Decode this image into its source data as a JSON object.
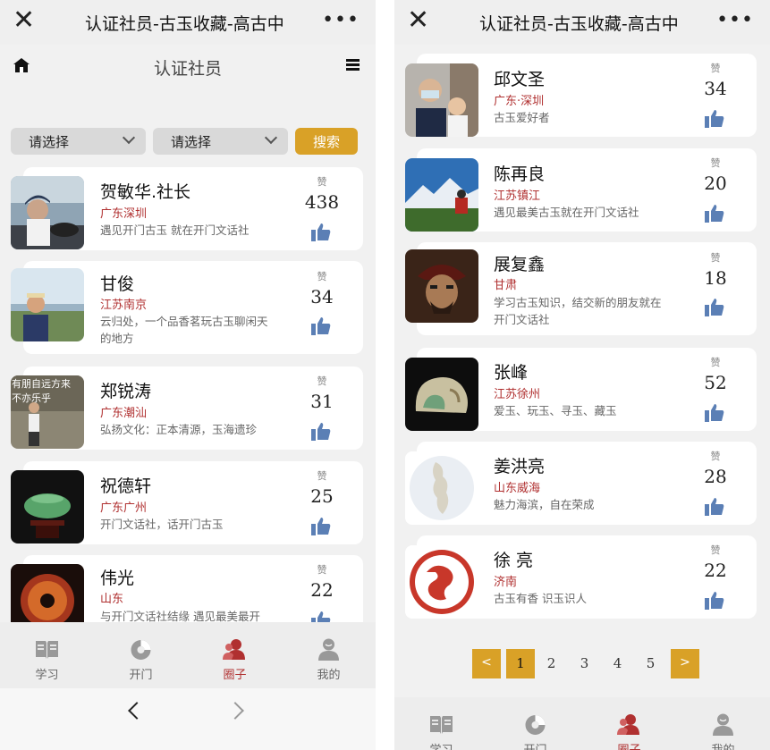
{
  "app": {
    "title": "认证社员-古玉收藏-高古中",
    "page_title": "认证社员",
    "close": "✕",
    "more": "•••"
  },
  "filters": {
    "select1": "请选择",
    "select2": "请选择",
    "search": "搜索"
  },
  "like_label": "赞",
  "left_members": [
    {
      "name": "贺敏华.社长",
      "location": "广东深圳",
      "motto": "遇见开门古玉 就在开门文话社",
      "likes": "438"
    },
    {
      "name": "甘俊",
      "location": "江苏南京",
      "motto": "云归处，一个品香茗玩古玉聊闲天的地方",
      "likes": "34"
    },
    {
      "name": "郑锐涛",
      "location": "广东潮汕",
      "motto": "弘扬文化：正本清源，玉海遗珍",
      "likes": "31",
      "photo_text": "有朋自远方来 不亦乐乎"
    },
    {
      "name": "祝德轩",
      "location": "广东广州",
      "motto": "开门文话社，话开门古玉",
      "likes": "25"
    },
    {
      "name": "伟光",
      "location": "山东",
      "motto": "与开门文话社结缘 遇见最美最开",
      "likes": "22"
    }
  ],
  "right_members": [
    {
      "name": "邱文圣",
      "location": "广东·深圳",
      "motto": "古玉爱好者",
      "likes": "34"
    },
    {
      "name": "陈再良",
      "location": "江苏镇江",
      "motto": "遇见最美古玉就在开门文话社",
      "likes": "20"
    },
    {
      "name": "展复鑫",
      "location": "甘肃",
      "motto": "学习古玉知识，结交新的朋友就在开门文话社",
      "likes": "18"
    },
    {
      "name": "张峰",
      "location": "江苏徐州",
      "motto": "爱玉、玩玉、寻玉、藏玉",
      "likes": "52"
    },
    {
      "name": "姜洪亮",
      "location": "山东威海",
      "motto": "魅力海滨，自在荣成",
      "likes": "28"
    },
    {
      "name": "徐 亮",
      "location": "济南",
      "motto": "古玉有香 识玉识人",
      "likes": "22"
    }
  ],
  "pagination": {
    "prev": "<",
    "next": ">",
    "pages": [
      "1",
      "2",
      "3",
      "4",
      "5"
    ],
    "current": "1"
  },
  "tabs": [
    {
      "label": "学习",
      "icon": "book-icon"
    },
    {
      "label": "开门",
      "icon": "jade-disc-icon"
    },
    {
      "label": "圈子",
      "icon": "people-icon"
    },
    {
      "label": "我的",
      "icon": "user-icon"
    }
  ],
  "colors": {
    "accent": "#d9a127",
    "location_red": "#b03030",
    "thumb_blue": "#5b7fb5",
    "active_tab": "#b03030"
  }
}
